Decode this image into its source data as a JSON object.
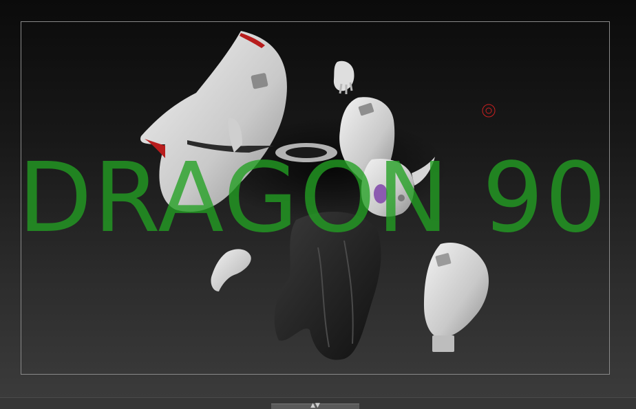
{
  "viewport": {
    "overlay_text": "DRAGON 90",
    "overlay_color": "#22a022"
  },
  "canvas_items": [
    {
      "name": "white-robe-piece",
      "color": "#dcdcdc"
    },
    {
      "name": "hand-piece",
      "color": "#e2e2e2"
    },
    {
      "name": "sleeve-piece",
      "color": "#d8d8d8"
    },
    {
      "name": "boot-piece",
      "color": "#d4d4d4"
    },
    {
      "name": "dark-pants-piece",
      "color": "#2a2a2a"
    },
    {
      "name": "foot-piece",
      "color": "#d6d6d6"
    }
  ],
  "bottom_tray": {
    "handle_icons": "▲▼"
  },
  "accent_colors": {
    "pivot_marker": "#cc2020",
    "frame_border": "#8a8a8a"
  }
}
